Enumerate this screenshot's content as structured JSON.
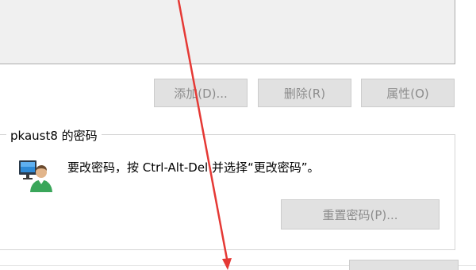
{
  "buttons": {
    "add_label": "添加(D)...",
    "remove_label": "删除(R)",
    "properties_label": "属性(O)"
  },
  "password_group": {
    "title": "pkaust8 的密码",
    "instruction": "要改密码，按 Ctrl-Alt-Del 并选择“更改密码”。",
    "reset_button_label": "重置密码(P)...",
    "user_icon": "user-monitor-icon"
  },
  "colors": {
    "annotation_arrow": "#e53935",
    "button_face": "#e1e1e1",
    "disabled_text": "#8c8c8c"
  },
  "icons": [
    "user-monitor-icon",
    "annotation-arrow-icon"
  ]
}
